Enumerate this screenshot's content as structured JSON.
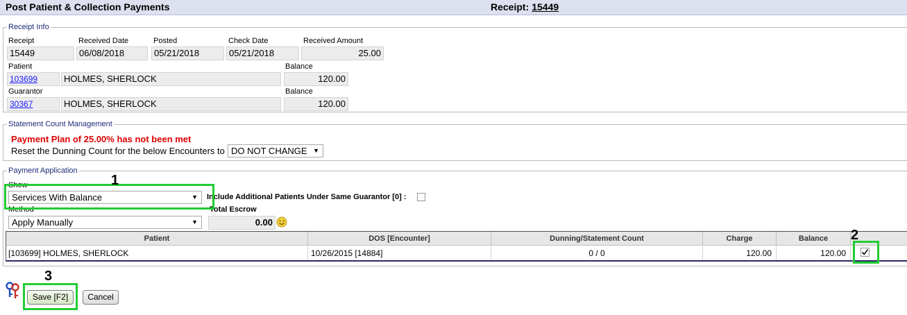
{
  "header": {
    "title": "Post Patient & Collection Payments",
    "receipt_label": "Receipt:",
    "receipt_number": "15449"
  },
  "receipt_info": {
    "legend": "Receipt Info",
    "receipt_label": "Receipt",
    "receipt_value": "15449",
    "received_date_label": "Received Date",
    "received_date_value": "06/08/2018",
    "posted_label": "Posted",
    "posted_value": "05/21/2018",
    "check_date_label": "Check Date",
    "check_date_value": "05/21/2018",
    "received_amount_label": "Received Amount",
    "received_amount_value": "25.00",
    "patient_label": "Patient",
    "patient_id": "103699",
    "patient_name": "HOLMES, SHERLOCK",
    "patient_balance_label": "Balance",
    "patient_balance": "120.00",
    "guarantor_label": "Guarantor",
    "guarantor_id": "30367",
    "guarantor_name": "HOLMES, SHERLOCK",
    "guarantor_balance_label": "Balance",
    "guarantor_balance": "120.00"
  },
  "statement": {
    "legend": "Statement Count Management",
    "warning": "Payment Plan of 25.00% has not been met",
    "reset_label": "Reset the Dunning Count for the below Encounters to",
    "reset_value": "DO NOT CHANGE"
  },
  "payment_app": {
    "legend": "Payment Application",
    "show_label": "Show",
    "show_value": "Services With Balance",
    "include_label": "Include Additional Patients Under Same Guarantor [0] :",
    "method_label": "Method",
    "method_value": "Apply Manually",
    "escrow_label": "Total Escrow",
    "escrow_value": "0.00"
  },
  "table": {
    "headers": [
      "Patient",
      "DOS [Encounter]",
      "Dunning/Statement Count",
      "Charge",
      "Balance"
    ],
    "rows": [
      {
        "patient": "[103699] HOLMES, SHERLOCK",
        "dos": "10/26/2015 [14884]",
        "count": "0 / 0",
        "charge": "120.00",
        "balance": "120.00",
        "checked": true
      }
    ]
  },
  "buttons": {
    "save": "Save [F2]",
    "cancel": "Cancel"
  },
  "callouts": [
    "1",
    "2",
    "3"
  ],
  "colors": {
    "highlight": "#22cc33",
    "warning": "#dd0000",
    "legend": "#1d2a78"
  }
}
